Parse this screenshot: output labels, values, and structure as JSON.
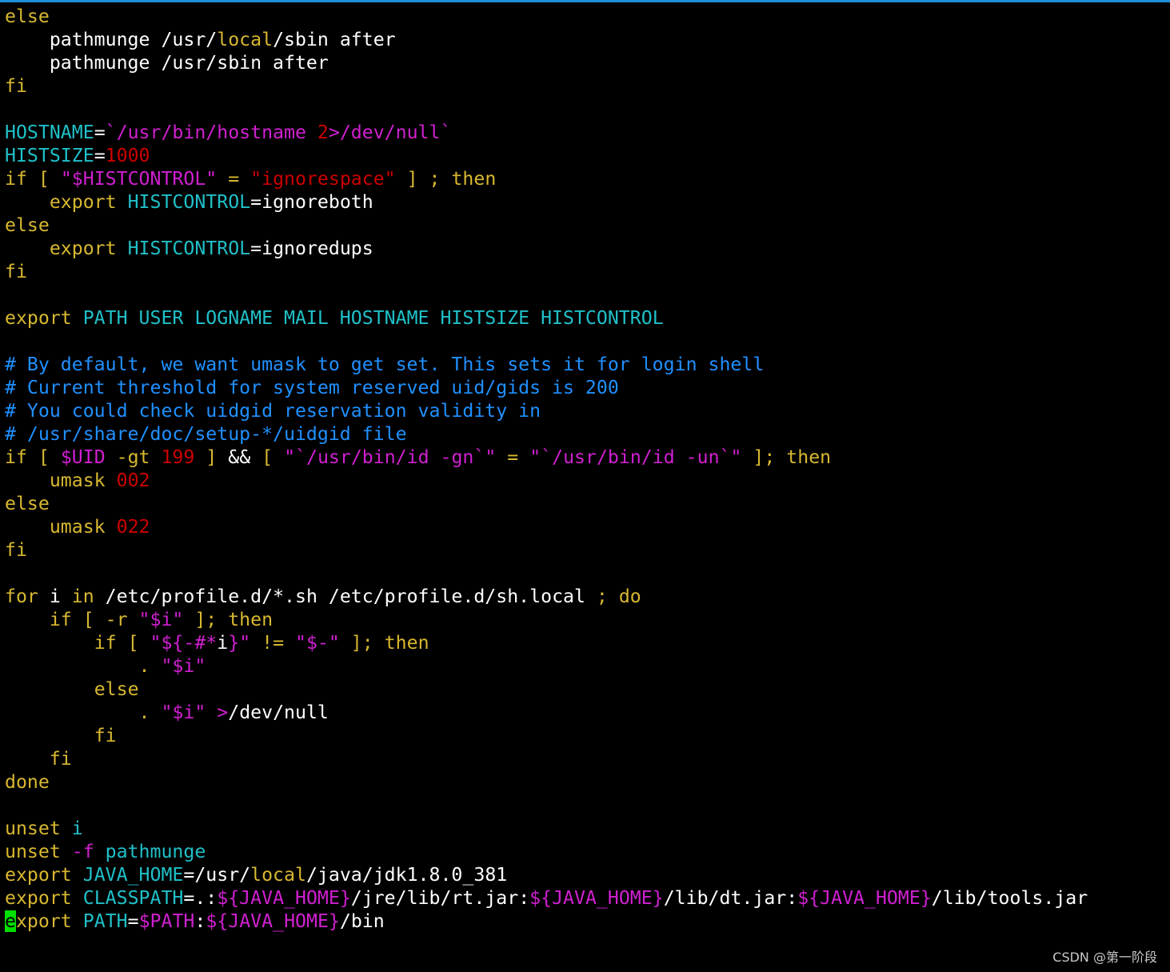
{
  "colors": {
    "background": "#000000",
    "topBorder": "#1f8fd8",
    "cursor": "#00e000",
    "watermark": "#c8c8c8"
  },
  "palette": {
    "w": "#ffffff",
    "y": "#d8b830",
    "c": "#20c0c8",
    "m": "#d020d0",
    "r": "#cc0000",
    "b": "#2090ff"
  },
  "lines": [
    [
      [
        "else",
        "y"
      ]
    ],
    [
      [
        "    pathmunge /usr/",
        "w"
      ],
      [
        "local",
        "y"
      ],
      [
        "/sbin after",
        "w"
      ]
    ],
    [
      [
        "    pathmunge /usr/sbin after",
        "w"
      ]
    ],
    [
      [
        "fi",
        "y"
      ]
    ],
    [],
    [
      [
        "HOSTNAME",
        "c"
      ],
      [
        "=",
        "w"
      ],
      [
        "`/usr/bin/hostname ",
        "m"
      ],
      [
        "2",
        "r"
      ],
      [
        ">/dev/null`",
        "m"
      ]
    ],
    [
      [
        "HISTSIZE",
        "c"
      ],
      [
        "=",
        "w"
      ],
      [
        "1000",
        "r"
      ]
    ],
    [
      [
        "if",
        "y"
      ],
      [
        " [ ",
        "y"
      ],
      [
        "\"$HISTCONTROL\"",
        "m"
      ],
      [
        " = ",
        "y"
      ],
      [
        "\"ignorespace\"",
        "r"
      ],
      [
        " ] ; ",
        "y"
      ],
      [
        "then",
        "y"
      ]
    ],
    [
      [
        "    ",
        "w"
      ],
      [
        "export",
        "y"
      ],
      [
        " ",
        "w"
      ],
      [
        "HISTCONTROL",
        "c"
      ],
      [
        "=",
        "w"
      ],
      [
        "ignoreboth",
        "w"
      ]
    ],
    [
      [
        "else",
        "y"
      ]
    ],
    [
      [
        "    ",
        "w"
      ],
      [
        "export",
        "y"
      ],
      [
        " ",
        "w"
      ],
      [
        "HISTCONTROL",
        "c"
      ],
      [
        "=",
        "w"
      ],
      [
        "ignoredups",
        "w"
      ]
    ],
    [
      [
        "fi",
        "y"
      ]
    ],
    [],
    [
      [
        "export",
        "y"
      ],
      [
        " PATH USER LOGNAME MAIL HOSTNAME HISTSIZE HISTCONTROL",
        "c"
      ]
    ],
    [],
    [
      [
        "# By default, we want umask to get set. This sets it for login shell",
        "b"
      ]
    ],
    [
      [
        "# Current threshold for system reserved uid/gids is 200",
        "b"
      ]
    ],
    [
      [
        "# You could check uidgid reservation validity in",
        "b"
      ]
    ],
    [
      [
        "# /usr/share/doc/setup-*/uidgid file",
        "b"
      ]
    ],
    [
      [
        "if",
        "y"
      ],
      [
        " [ ",
        "y"
      ],
      [
        "$UID",
        "m"
      ],
      [
        " -gt ",
        "y"
      ],
      [
        "199",
        "r"
      ],
      [
        " ] ",
        "y"
      ],
      [
        "&&",
        "w"
      ],
      [
        " [ ",
        "y"
      ],
      [
        "\"`/usr/bin/id -gn`\"",
        "m"
      ],
      [
        " = ",
        "y"
      ],
      [
        "\"`/usr/bin/id -un`\"",
        "m"
      ],
      [
        " ]; ",
        "y"
      ],
      [
        "then",
        "y"
      ]
    ],
    [
      [
        "    ",
        "w"
      ],
      [
        "umask",
        "y"
      ],
      [
        " ",
        "w"
      ],
      [
        "002",
        "r"
      ]
    ],
    [
      [
        "else",
        "y"
      ]
    ],
    [
      [
        "    ",
        "w"
      ],
      [
        "umask",
        "y"
      ],
      [
        " ",
        "w"
      ],
      [
        "022",
        "r"
      ]
    ],
    [
      [
        "fi",
        "y"
      ]
    ],
    [],
    [
      [
        "for",
        "y"
      ],
      [
        " i ",
        "w"
      ],
      [
        "in",
        "y"
      ],
      [
        " /etc/profile.d/*.sh /etc/profile.d/sh.local ",
        "w"
      ],
      [
        "; ",
        "y"
      ],
      [
        "do",
        "y"
      ]
    ],
    [
      [
        "    ",
        "w"
      ],
      [
        "if",
        "y"
      ],
      [
        " [ -r ",
        "y"
      ],
      [
        "\"$i\"",
        "m"
      ],
      [
        " ]; ",
        "y"
      ],
      [
        "then",
        "y"
      ]
    ],
    [
      [
        "        ",
        "w"
      ],
      [
        "if",
        "y"
      ],
      [
        " [ ",
        "y"
      ],
      [
        "\"${-#*",
        "m"
      ],
      [
        "i",
        "w"
      ],
      [
        "}\"",
        "m"
      ],
      [
        " != ",
        "y"
      ],
      [
        "\"$-\"",
        "m"
      ],
      [
        " ]; ",
        "y"
      ],
      [
        "then",
        "y"
      ]
    ],
    [
      [
        "            ",
        "w"
      ],
      [
        ".",
        "y"
      ],
      [
        " ",
        "w"
      ],
      [
        "\"$i\"",
        "m"
      ]
    ],
    [
      [
        "        ",
        "w"
      ],
      [
        "else",
        "y"
      ]
    ],
    [
      [
        "            ",
        "w"
      ],
      [
        ".",
        "y"
      ],
      [
        " ",
        "w"
      ],
      [
        "\"$i\"",
        "m"
      ],
      [
        " ",
        "w"
      ],
      [
        ">",
        "m"
      ],
      [
        "/dev/null",
        "w"
      ]
    ],
    [
      [
        "        ",
        "w"
      ],
      [
        "fi",
        "y"
      ]
    ],
    [
      [
        "    ",
        "w"
      ],
      [
        "fi",
        "y"
      ]
    ],
    [
      [
        "done",
        "y"
      ]
    ],
    [],
    [
      [
        "unset",
        "y"
      ],
      [
        " ",
        "w"
      ],
      [
        "i",
        "c"
      ]
    ],
    [
      [
        "unset",
        "y"
      ],
      [
        " ",
        "w"
      ],
      [
        "-f",
        "m"
      ],
      [
        " ",
        "w"
      ],
      [
        "pathmunge",
        "c"
      ]
    ],
    [
      [
        "export",
        "y"
      ],
      [
        " ",
        "w"
      ],
      [
        "JAVA_HOME",
        "c"
      ],
      [
        "=/usr/",
        "w"
      ],
      [
        "local",
        "y"
      ],
      [
        "/java/jdk1.8.0_381",
        "w"
      ]
    ],
    [
      [
        "export",
        "y"
      ],
      [
        " ",
        "w"
      ],
      [
        "CLASSPATH",
        "c"
      ],
      [
        "=.:",
        "w"
      ],
      [
        "${JAVA_HOME}",
        "m"
      ],
      [
        "/jre/lib/rt.jar:",
        "w"
      ],
      [
        "${JAVA_HOME}",
        "m"
      ],
      [
        "/lib/dt.jar:",
        "w"
      ],
      [
        "${JAVA_HOME}",
        "m"
      ],
      [
        "/lib/tools.jar",
        "w"
      ]
    ],
    [
      [
        "e",
        "cursor"
      ],
      [
        "xport",
        "y"
      ],
      [
        " ",
        "w"
      ],
      [
        "PATH",
        "c"
      ],
      [
        "=",
        "w"
      ],
      [
        "$PATH",
        "m"
      ],
      [
        ":",
        "w"
      ],
      [
        "${JAVA_HOME}",
        "m"
      ],
      [
        "/bin",
        "w"
      ]
    ]
  ],
  "watermark": "CSDN @第一阶段"
}
